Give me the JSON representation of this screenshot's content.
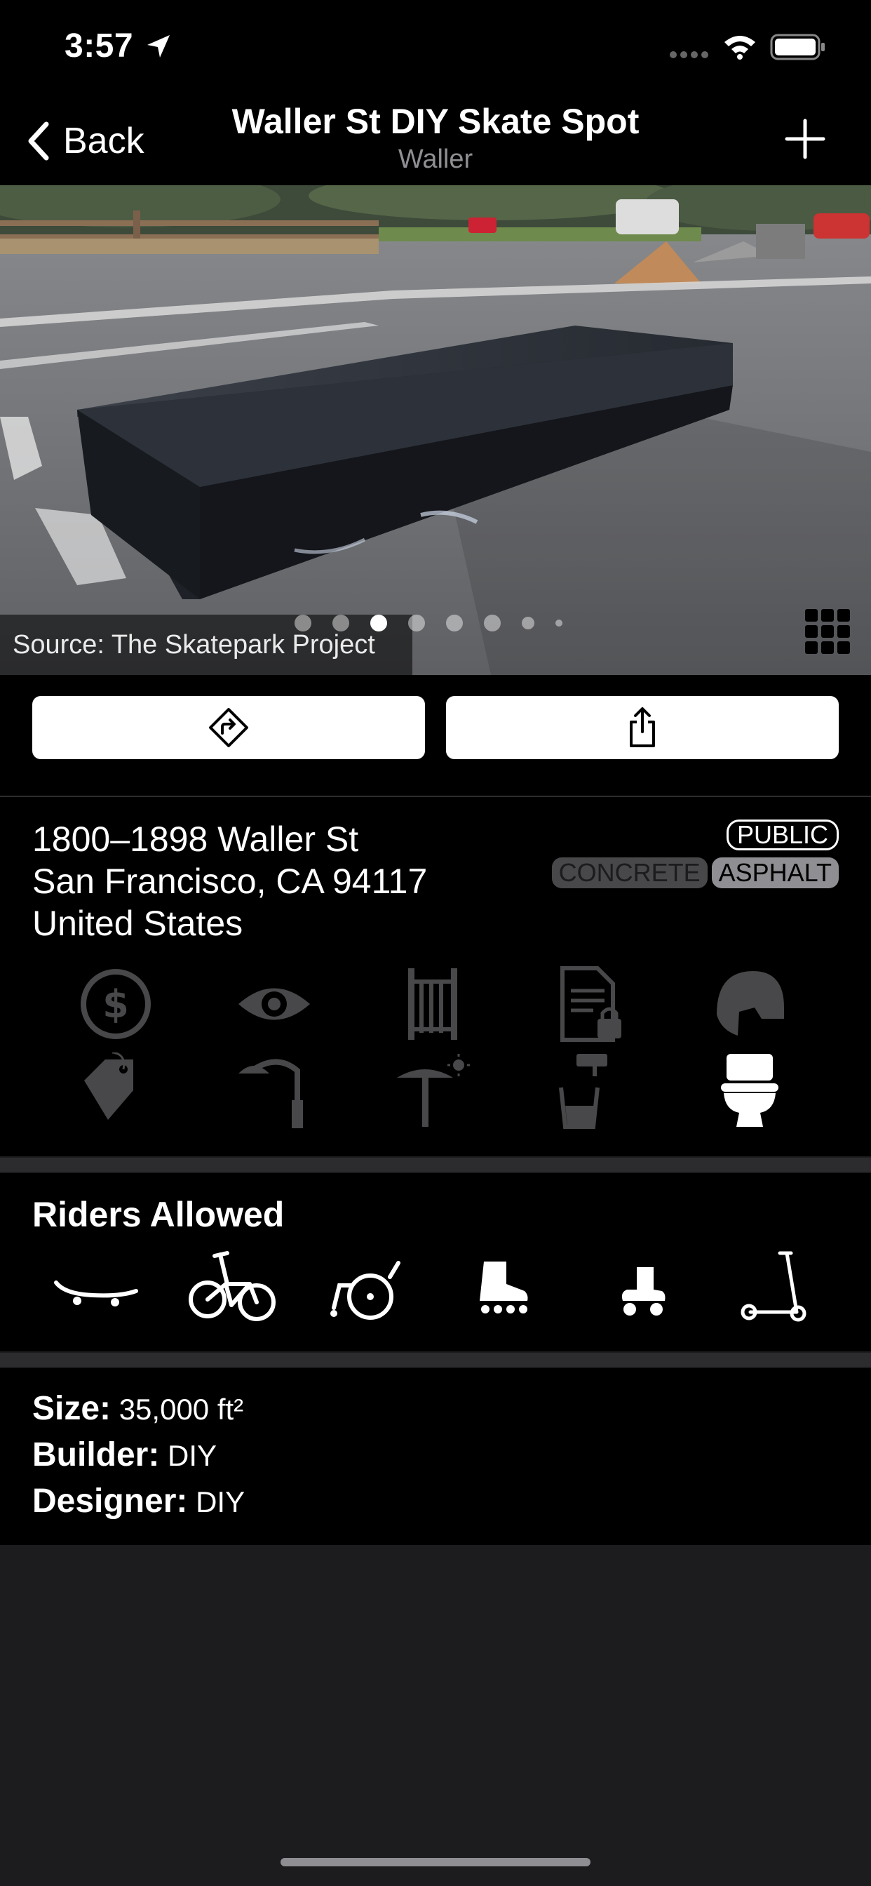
{
  "status_bar": {
    "time": "3:57",
    "icons": [
      "location-arrow-icon",
      "signal-icon",
      "wifi-icon",
      "battery-icon"
    ]
  },
  "nav": {
    "back_label": "Back",
    "title": "Waller St DIY Skate Spot",
    "subtitle": "Waller",
    "add_icon": "plus-icon"
  },
  "photo": {
    "source": "Source: The Skatepark Project",
    "page_count": 8,
    "active_page": 3,
    "grid_icon": "grid-icon"
  },
  "actions": {
    "directions_icon": "directions-icon",
    "share_icon": "share-icon"
  },
  "address": {
    "line1": "1800–1898 Waller St",
    "line2": "San Francisco, CA 94117",
    "line3": "United States",
    "access_badge": "PUBLIC",
    "surfaces": [
      {
        "label": "CONCRETE",
        "active": false
      },
      {
        "label": "ASPHALT",
        "active": true
      }
    ]
  },
  "amenities": [
    {
      "icon": "fee-dollar-icon",
      "active": false
    },
    {
      "icon": "eye-icon",
      "active": false
    },
    {
      "icon": "fence-gate-icon",
      "active": false
    },
    {
      "icon": "waiver-document-icon",
      "active": false
    },
    {
      "icon": "helmet-icon",
      "active": false
    },
    {
      "icon": "price-tag-icon",
      "active": false
    },
    {
      "icon": "street-light-icon",
      "active": false
    },
    {
      "icon": "shade-umbrella-icon",
      "active": false
    },
    {
      "icon": "water-fountain-icon",
      "active": false
    },
    {
      "icon": "toilet-icon",
      "active": true
    }
  ],
  "riders": {
    "title": "Riders Allowed",
    "types": [
      "skateboard-icon",
      "bmx-bike-icon",
      "wheelchair-icon",
      "inline-skate-icon",
      "roller-skate-icon",
      "scooter-icon"
    ]
  },
  "specs": {
    "size_label": "Size:",
    "size_value": "35,000 ft²",
    "builder_label": "Builder:",
    "builder_value": "DIY",
    "designer_label": "Designer:",
    "designer_value": "DIY"
  },
  "colors": {
    "background": "#1c1c1e",
    "card": "#000000",
    "inactive_icon": "#48484a",
    "active_icon": "#ffffff",
    "secondary_text": "#8e8e93"
  }
}
